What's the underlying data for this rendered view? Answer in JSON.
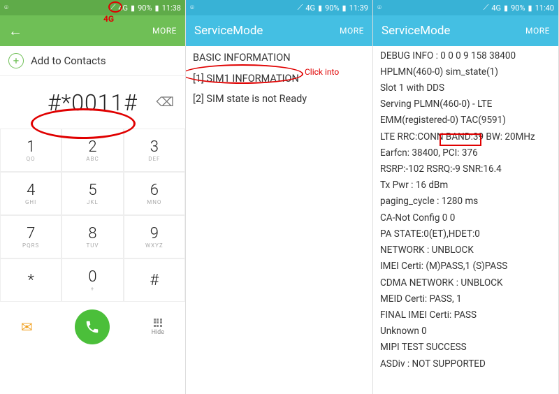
{
  "pane1": {
    "status": {
      "battery": "90%",
      "time": "11:38",
      "net": "4G"
    },
    "header": {
      "more": "MORE"
    },
    "add_contacts": "Add to Contacts",
    "dial_number": "#*0011#",
    "keypad": [
      {
        "d": "1",
        "l": "QO"
      },
      {
        "d": "2",
        "l": "ABC"
      },
      {
        "d": "3",
        "l": "DEF"
      },
      {
        "d": "4",
        "l": "GHI"
      },
      {
        "d": "5",
        "l": "JKL"
      },
      {
        "d": "6",
        "l": "MNO"
      },
      {
        "d": "7",
        "l": "PQRS"
      },
      {
        "d": "8",
        "l": "TUV"
      },
      {
        "d": "9",
        "l": "WXYZ"
      },
      {
        "d": "*",
        "l": ""
      },
      {
        "d": "0",
        "l": "+"
      },
      {
        "d": "#",
        "l": ""
      }
    ],
    "hide_label": "Hide",
    "anno_4g": "4G"
  },
  "pane2": {
    "status": {
      "battery": "90%",
      "time": "11:39",
      "net": "4G"
    },
    "title": "ServiceMode",
    "more": "MORE",
    "items": [
      "BASIC INFORMATION",
      "[1] SIM1 INFORMATION",
      "[2] SIM state is not Ready"
    ],
    "anno_click": "Click into"
  },
  "pane3": {
    "status": {
      "battery": "90%",
      "time": "11:40",
      "net": "4G"
    },
    "title": "ServiceMode",
    "more": "MORE",
    "items": [
      "DEBUG INFO : 0 0 0 9 158 38400",
      "HPLMN(460-0) sim_state(1)",
      "Slot 1 with DDS",
      "Serving PLMN(460-0) - LTE",
      "EMM(registered-0) TAC(9591)",
      "LTE RRC:CONN BAND:39 BW: 20MHz",
      "Earfcn: 38400, PCI: 376",
      "RSRP:-102 RSRQ:-9 SNR:16.4",
      "Tx Pwr : 16 dBm",
      "paging_cycle : 1280 ms",
      "CA-Not Config 0 0",
      "PA STATE:0(ET),HDET:0",
      "NETWORK : UNBLOCK",
      "IMEI Certi: (M)PASS,1 (S)PASS",
      "CDMA NETWORK : UNBLOCK",
      "MEID Certi: PASS, 1",
      "FINAL IMEI Certi: PASS",
      "Unknown 0",
      "MIPI TEST SUCCESS",
      "ASDiv : NOT SUPPORTED"
    ]
  }
}
